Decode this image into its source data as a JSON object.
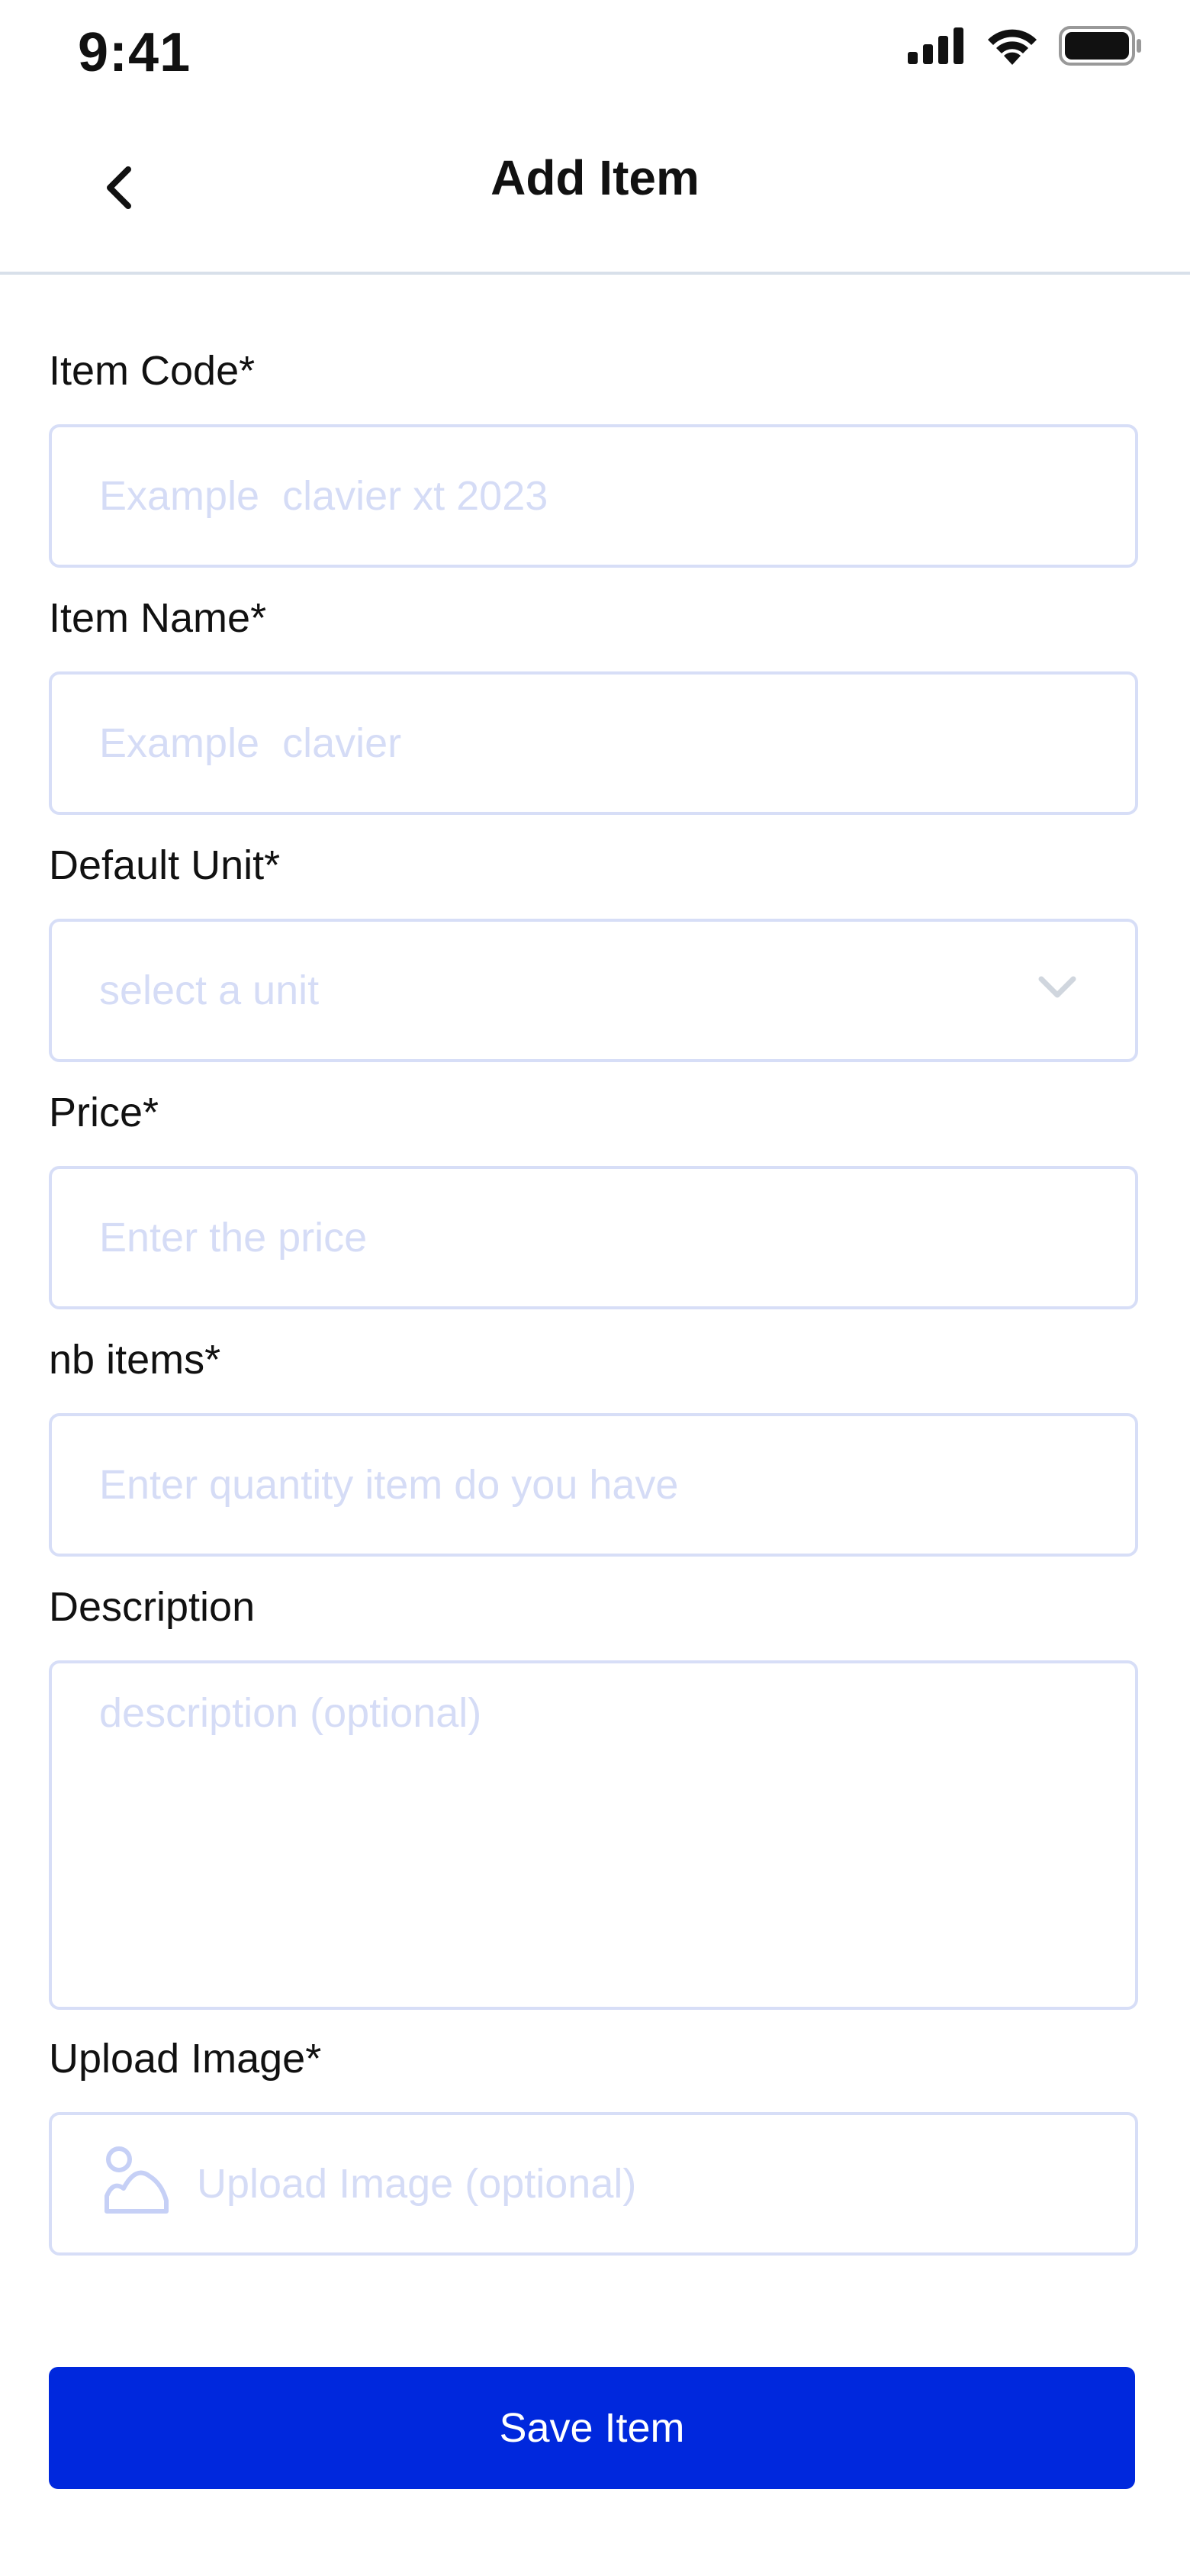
{
  "status_bar": {
    "time": "9:41",
    "icons": [
      "cellular-signal-icon",
      "wifi-icon",
      "battery-icon"
    ]
  },
  "header": {
    "title": "Add Item",
    "back_icon": "chevron-left-icon"
  },
  "form": {
    "item_code": {
      "label": "Item Code*",
      "placeholder": "Example  clavier xt 2023",
      "value": ""
    },
    "item_name": {
      "label": "Item Name*",
      "placeholder": "Example  clavier",
      "value": ""
    },
    "default_unit": {
      "label": "Default Unit*",
      "placeholder": "select a unit",
      "icon": "chevron-down-icon"
    },
    "price": {
      "label": "Price*",
      "placeholder": "Enter the price",
      "value": ""
    },
    "nb_items": {
      "label": "nb items*",
      "placeholder": "Enter quantity item do you have",
      "value": ""
    },
    "description": {
      "label": "Description",
      "placeholder": "description (optional)",
      "value": ""
    },
    "upload_image": {
      "label": "Upload Image*",
      "placeholder": "Upload Image (optional)",
      "icon": "image-icon"
    }
  },
  "actions": {
    "save_label": "Save Item"
  },
  "colors": {
    "primary": "#0028dd",
    "input_border": "#d7def7",
    "placeholder": "#d5dcf6",
    "divider": "#d8e0ea"
  }
}
